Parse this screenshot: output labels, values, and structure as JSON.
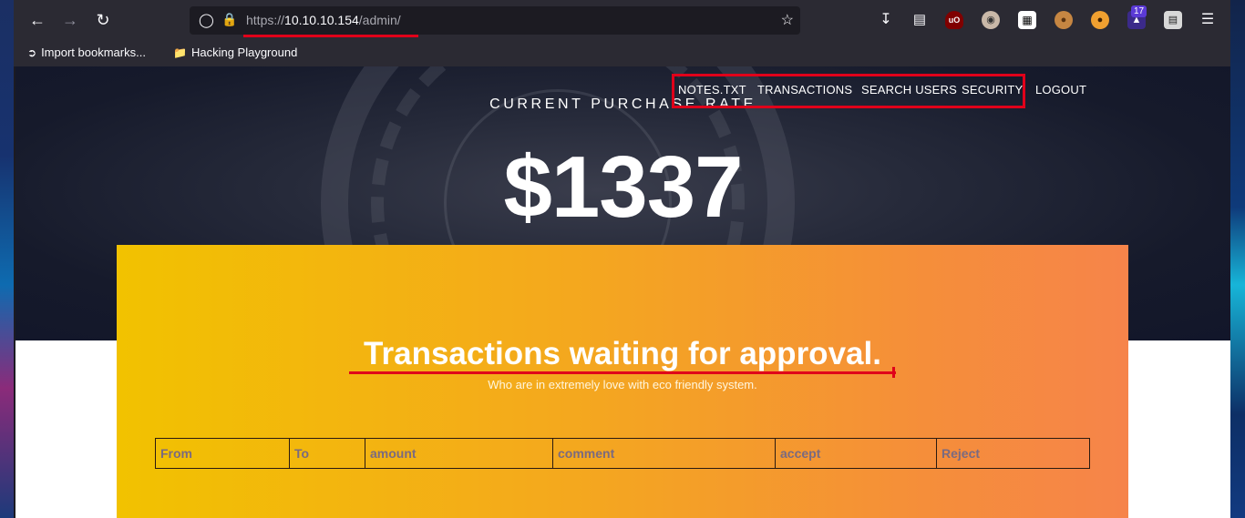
{
  "browser": {
    "url_scheme": "https://",
    "url_host": "10.10.10.154",
    "url_path": "/admin/",
    "extension_badge_count": "17",
    "bookmarks": [
      {
        "label": "Import bookmarks..."
      },
      {
        "label": "Hacking Playground"
      }
    ]
  },
  "site": {
    "nav": [
      "NOTES.TXT",
      "TRANSACTIONS",
      "SEARCH USERS",
      "SECURITY",
      "LOGOUT"
    ],
    "rate_label": "CURRENT PURCHASE RATE",
    "rate_value": "$1337",
    "panel_title": "Transactions waiting for approval.",
    "panel_subtitle": "Who are in extremely love with eco friendly system.",
    "table_headers": [
      "From",
      "To",
      "amount",
      "comment",
      "accept",
      "Reject"
    ]
  },
  "colors": {
    "annotation_red": "#e0001a",
    "panel_gradient_start": "#f2c200",
    "panel_gradient_end": "#f6844a"
  }
}
